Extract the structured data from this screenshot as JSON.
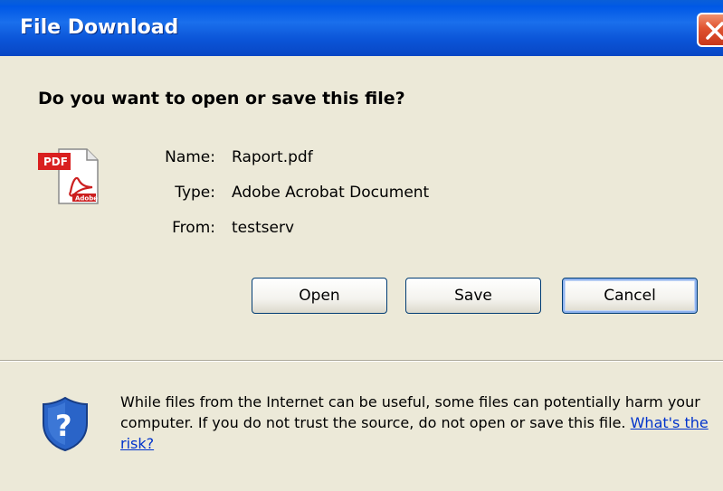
{
  "window": {
    "title": "File Download"
  },
  "dialog": {
    "question": "Do you want to open or save this file?",
    "file": {
      "icon": "pdf-file-icon",
      "name_label": "Name:",
      "name_value": "Raport.pdf",
      "type_label": "Type:",
      "type_value": "Adobe Acrobat Document",
      "from_label": "From:",
      "from_value": "testserv"
    },
    "buttons": {
      "open": "Open",
      "save": "Save",
      "cancel": "Cancel"
    },
    "warning": {
      "icon": "security-shield-icon",
      "text": "While files from the Internet can be useful, some files can potentially harm your computer. If you do not trust the source, do not open or save this file.",
      "link": "What's the risk?"
    }
  },
  "colors": {
    "titlebar": "#0058e6",
    "dialog_bg": "#ece9d8",
    "close_button": "#e0532f",
    "link": "#0033cc"
  }
}
